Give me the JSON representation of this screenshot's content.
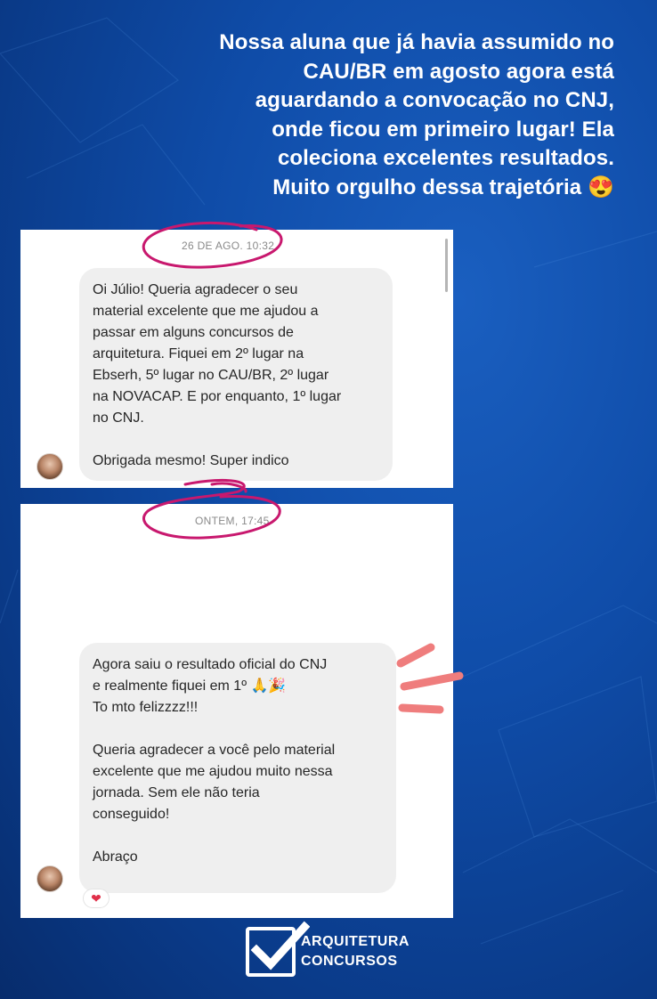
{
  "headline": {
    "lines": [
      "Nossa aluna que já havia assumido no",
      "CAU/BR em agosto agora está",
      "aguardando a convocação no CNJ,",
      "onde ficou em primeiro lugar! Ela",
      "coleciona excelentes resultados.",
      "Muito orgulho dessa trajetória 😍"
    ]
  },
  "chat1": {
    "timestamp": "26 DE AGO. 10:32",
    "message_lines": "Oi Júlio! Queria agradecer o seu\nmaterial excelente que me ajudou a\npassar em alguns concursos de\narquitetura. Fiquei em 2º lugar na\nEbserh, 5º lugar no CAU/BR, 2º lugar\nna NOVACAP. E por enquanto, 1º lugar\nno CNJ.",
    "message_end": "Obrigada mesmo! Super indico"
  },
  "chat2": {
    "timestamp": "ONTEM, 17:45",
    "para1": "Agora saiu o resultado oficial do CNJ\ne realmente fiquei em 1º 🙏🎉\nTo mto felizzzz!!!",
    "para2": "Queria agradecer a você pelo material\nexcelente que me ajudou muito nessa\njornada. Sem ele não teria\nconseguido!",
    "para3": "Abraço",
    "reaction": "❤"
  },
  "brand": {
    "line1": "ARQUITETURA",
    "line2": "CONCURSOS"
  },
  "colors": {
    "background": "#0f4ca8",
    "annotation_circle": "#c8186e",
    "annotation_strokes": "#ef7d7d"
  }
}
